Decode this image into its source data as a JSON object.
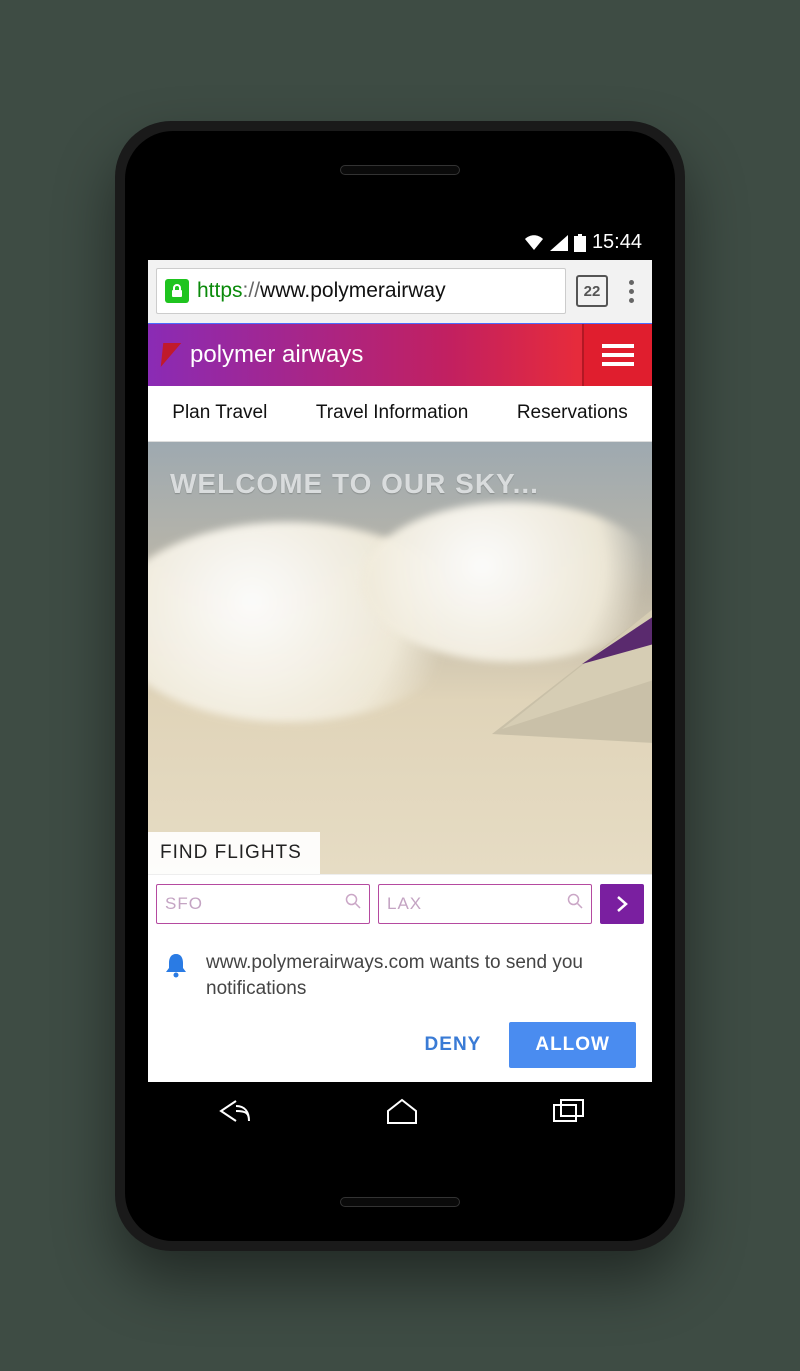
{
  "status": {
    "time": "15:44"
  },
  "browser": {
    "url_scheme": "https",
    "url_sep": "://",
    "url_rest": "www.polymerairway",
    "tab_count": "22"
  },
  "header": {
    "brand": "polymer airways"
  },
  "tabs": {
    "plan": "Plan Travel",
    "info": "Travel Information",
    "reservations": "Reservations"
  },
  "hero": {
    "title": "WELCOME TO OUR SKY..."
  },
  "find": {
    "label": "FIND FLIGHTS",
    "from_placeholder": "SFO",
    "to_placeholder": "LAX"
  },
  "permission": {
    "message": "www.polymerairways.com wants to send you notifications",
    "deny": "DENY",
    "allow": "ALLOW"
  }
}
